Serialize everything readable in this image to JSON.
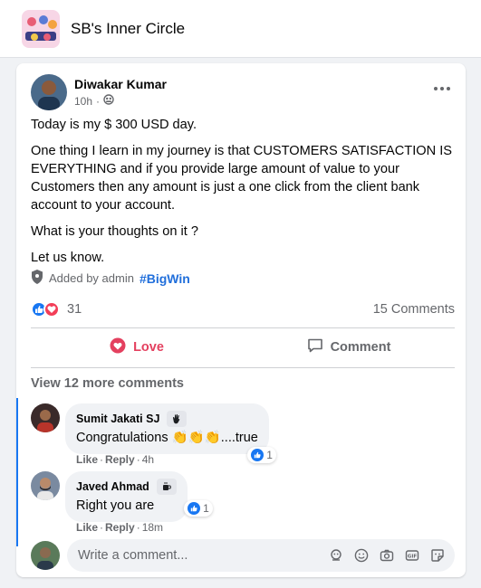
{
  "group": {
    "name": "SB's Inner Circle"
  },
  "post": {
    "author": "Diwakar Kumar",
    "time": "10h",
    "paragraphs": [
      "Today is my $ 300 USD day.",
      "One thing I learn in my journey is that CUSTOMERS SATISFACTION IS EVERYTHING and if you provide large amount of value to your Customers then any amount is just a one click from the client bank account to your account.",
      "What is your thoughts on it ?",
      "Let us know."
    ],
    "added_by": "Added by admin",
    "hashtag": "#BigWin",
    "reaction_count": "31",
    "comment_count": "15 Comments"
  },
  "actions": {
    "love": "Love",
    "comment": "Comment"
  },
  "view_more": "View 12 more comments",
  "comments": [
    {
      "author": "Sumit Jakati SJ",
      "text_prefix": "Congratulations ",
      "emoji": "👏👏👏",
      "text_suffix": "....true",
      "likes": "1",
      "like_label": "Like",
      "reply_label": "Reply",
      "time": "4h"
    },
    {
      "author": "Javed Ahmad",
      "text": "Right you are",
      "likes": "1",
      "like_label": "Like",
      "reply_label": "Reply",
      "time": "18m"
    }
  ],
  "composer": {
    "placeholder": "Write a comment..."
  },
  "colors": {
    "accent_blue": "#1877f2",
    "love_red": "#e4405f",
    "hashtag": "#216fdb"
  }
}
